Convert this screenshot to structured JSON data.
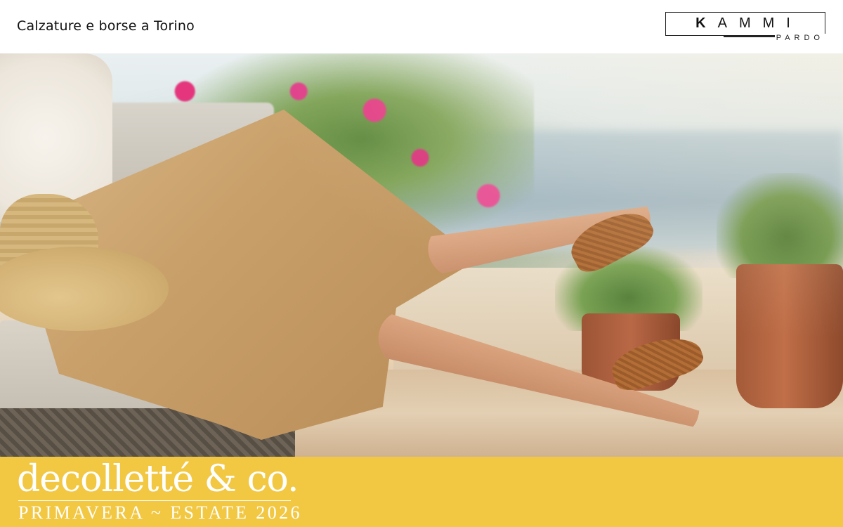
{
  "header": {
    "tagline": "Calzature e borse a Torino",
    "logo": {
      "initial": "K",
      "name_rest": "AMMI",
      "sub": "PARDO"
    }
  },
  "hero_image": {
    "icon": "photo-woman-terrace-slingback-shoes"
  },
  "banner": {
    "title": "decolletté & co.",
    "subtitle": "PRIMAVERA ~ ESTATE 2026",
    "background_color": "#f2c742",
    "text_color": "#ffffff"
  }
}
